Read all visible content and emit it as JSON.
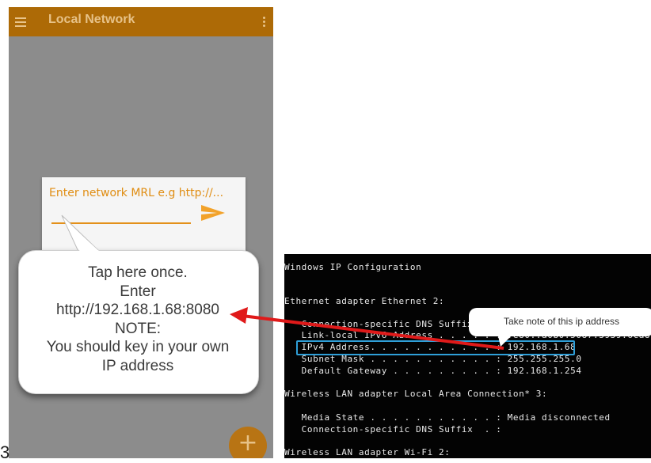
{
  "app": {
    "title": "Local Network",
    "mrl_placeholder": "Enter network MRL e.g http://...",
    "fab_label": "+"
  },
  "bubble": {
    "lines": [
      "Tap here once.",
      "Enter",
      "http://192.168.1.68:8080",
      "NOTE:",
      "You should key in your own",
      "IP address"
    ]
  },
  "step_number": "3",
  "terminal": {
    "lines": [
      "Windows IP Configuration",
      "",
      "",
      "Ethernet adapter Ethernet 2:",
      "",
      "   Connection-specific DNS Suffix  . :",
      "   Link-local IPv6 Address . . . . . : fe80::a0b0:5087:3939:6ca8%3",
      "   IPv4 Address. . . . . . . . . . . : 192.168.1.68",
      "   Subnet Mask . . . . . . . . . . . : 255.255.255.0",
      "   Default Gateway . . . . . . . . . : 192.168.1.254",
      "",
      "Wireless LAN adapter Local Area Connection* 3:",
      "",
      "   Media State . . . . . . . . . . . : Media disconnected",
      "   Connection-specific DNS Suffix  . :",
      "",
      "Wireless LAN adapter Wi-Fi 2:"
    ]
  },
  "callout": {
    "text": "Take note of this ip address"
  },
  "colors": {
    "appbar": "#ad6a06",
    "accent": "#e3901a",
    "arrow": "#e01a1a",
    "highlight": "#2f9fd8"
  },
  "icons": [
    "menu-icon",
    "more-vert-icon",
    "send-arrow-icon",
    "add-icon"
  ]
}
